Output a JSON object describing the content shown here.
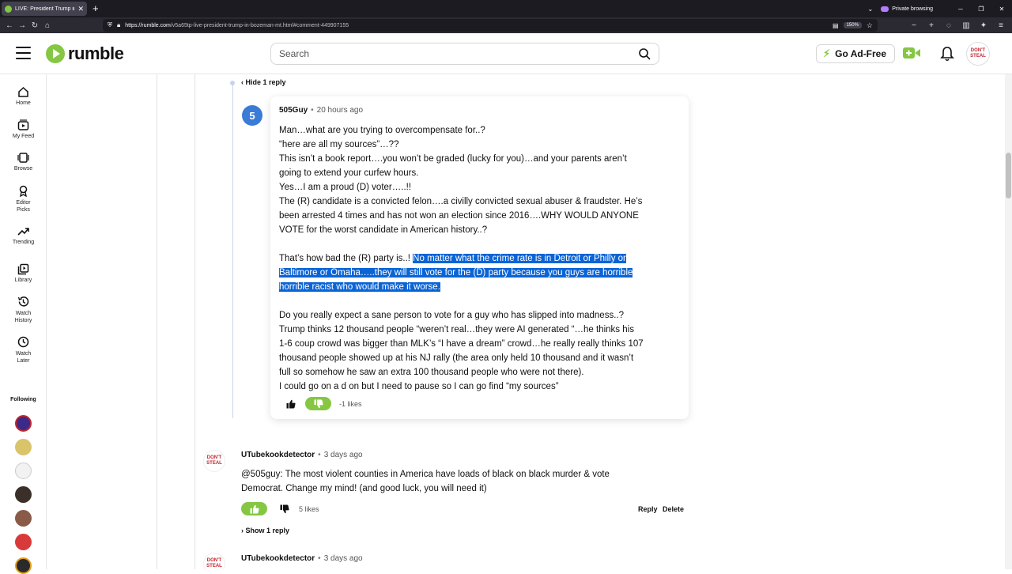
{
  "browser": {
    "tab_title": "LIVE: President Trump in Bozem",
    "url_domain": "https://rumble.com",
    "url_path": "/v5a65tp-live-president-trump-in-bozeman-mt.html#comment-449907155",
    "zoom": "150%",
    "private_label": "Private browsing"
  },
  "header": {
    "logo_text": "rumble",
    "search_placeholder": "Search",
    "go_ad_free": "Go Ad-Free",
    "avatar_text": "DON'T STEAL"
  },
  "sidebar": {
    "items": [
      {
        "label": "Home",
        "icon": "home-icon"
      },
      {
        "label": "My Feed",
        "icon": "feed-icon"
      },
      {
        "label": "Browse",
        "icon": "browse-icon"
      },
      {
        "label": "Editor Picks",
        "icon": "editor-picks-icon"
      },
      {
        "label": "Trending",
        "icon": "trending-icon"
      },
      {
        "label": "Library",
        "icon": "library-icon"
      },
      {
        "label": "Watch History",
        "icon": "history-icon"
      },
      {
        "label": "Watch Later",
        "icon": "clock-icon"
      }
    ],
    "following_label": "Following"
  },
  "thread": {
    "hide_reply": "‹ Hide 1 reply"
  },
  "comments": [
    {
      "user": "505Guy",
      "avatar_letter": "5",
      "time": "20 hours ago",
      "lines": [
        "Man…what are you trying to overcompensate for..?",
        "“here are all my sources”…??",
        "This isn’t a book report….you won’t be graded (lucky for you)…and your parents aren’t",
        "going to extend your curfew hours.",
        "Yes…I am a proud (D) voter…..!!",
        "The (R) candidate is a convicted felon….a civilly convicted sexual abuser & fraudster. He’s",
        "been arrested 4 times and has not won an election since 2016….WHY WOULD ANYONE",
        "VOTE for the worst candidate in American history..?"
      ],
      "para2_plain": "That’s how bad the (R) party is..! ",
      "para2_hl_1": "No matter what the crime rate is in Detroit or Philly or",
      "para2_hl_2": "Baltimore or Omaha…..they will still vote for the (D) party because you guys are horrible",
      "para2_hl_3": "horrible racist who would make it worse.",
      "lines3": [
        "Do you really expect a sane person to vote for a guy who has slipped into madness..?",
        "Trump thinks 12 thousand people “weren’t real…they were AI generated “…he thinks his",
        "1-6 coup crowd was bigger than MLK’s “I have a dream” crowd…he really really thinks 107",
        "thousand people showed up at his NJ rally (the area only held 10 thousand and it wasn’t",
        "full so somehow he saw an extra 100 thousand people who were not there).",
        "I could go on a d on but I need to pause so I can go find “my sources”"
      ],
      "likes": "-1 likes"
    },
    {
      "user": "UTubekookdetector",
      "time": "3 days ago",
      "avatar_text": "DON'T STEAL",
      "line1": "@505guy: The most violent counties in America have loads of black on black murder & vote",
      "line2": "Democrat. Change my mind! (and good luck, you will need it)",
      "likes": "5 likes",
      "reply": "Reply",
      "delete": "Delete",
      "show_reply": "› Show 1 reply"
    },
    {
      "user": "UTubekookdetector",
      "time": "3 days ago",
      "avatar_text": "DON'T STEAL"
    }
  ],
  "colors": {
    "accent": "#85c742",
    "selection": "#0a64d6",
    "avatar_blue": "#3a7bd5"
  }
}
